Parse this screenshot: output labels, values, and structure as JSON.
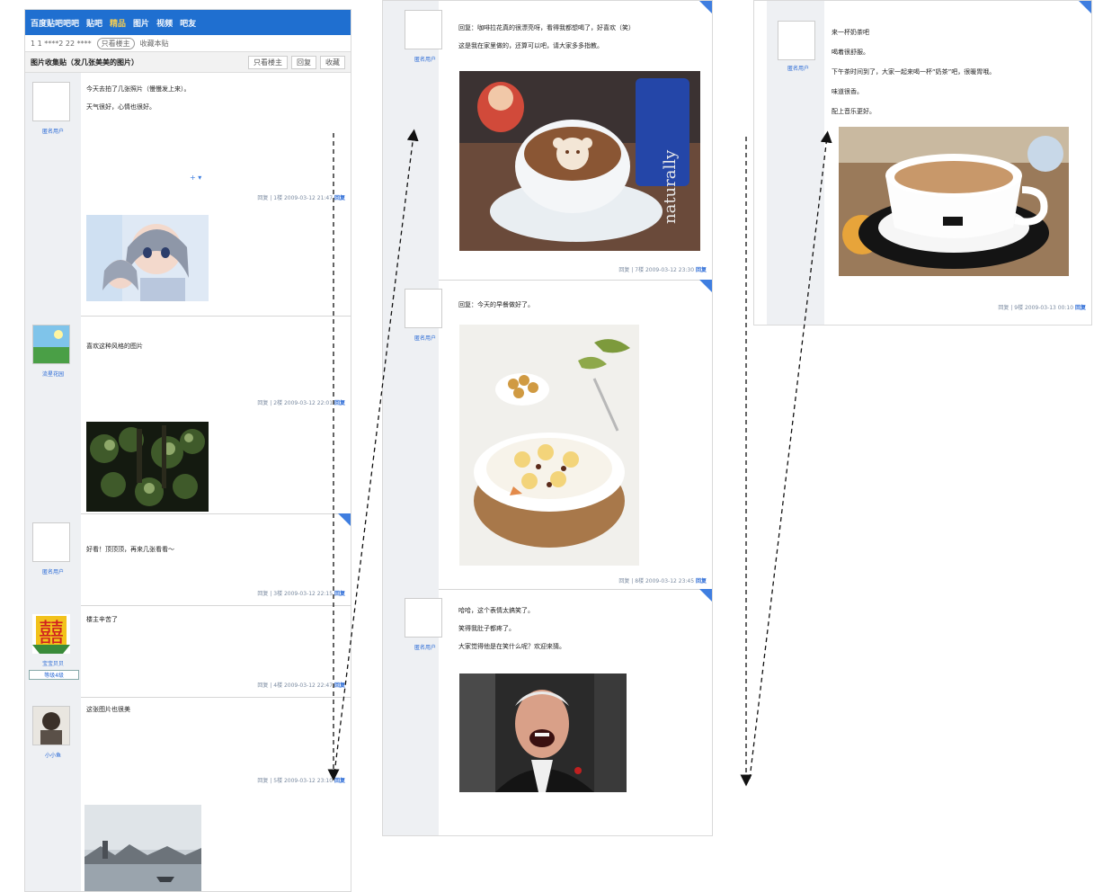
{
  "column1": {
    "topbar": {
      "title": "百度贴吧吧吧",
      "items": [
        "贴吧",
        "精品",
        "图片",
        "视频",
        "吧友"
      ]
    },
    "subbar": {
      "text": "1 1 ****2 22 ****",
      "pill": "只看楼主",
      "extra": "收藏本贴"
    },
    "thread": {
      "title": "图片收集贴（发几张美美的图片）",
      "tools": [
        "只看楼主",
        "回复",
        "收藏"
      ]
    },
    "posts": [
      {
        "user": "匿名用户",
        "lines": [
          "今天去拍了几张照片（慢慢发上来）。",
          "天气很好，心情也很好。"
        ],
        "plus": "+ ▾",
        "meta": "回复 | 1楼 2009-03-12 21:47",
        "reply": "回复"
      },
      {
        "user": "流星花园",
        "lines": [
          "喜欢这种风格的图片"
        ],
        "meta": "回复 | 2楼 2009-03-12 22:01",
        "reply": "回复"
      },
      {
        "user": "匿名用户",
        "lines": [
          "好看！顶顶顶，再来几张看看～"
        ],
        "meta": "回复 | 3楼 2009-03-12 22:15",
        "reply": "回复"
      },
      {
        "user": "宝宝贝贝",
        "badge": "等级4级",
        "lines": [
          "楼主辛苦了"
        ],
        "meta": "回复 | 4楼 2009-03-12 22:47",
        "reply": "回复"
      },
      {
        "user": "小小鱼",
        "lines": [
          "这张图片也很美"
        ],
        "meta": "回复 | 5楼 2009-03-12 23:10",
        "reply": "回复"
      }
    ]
  },
  "column2": {
    "posts": [
      {
        "user": "匿名用户",
        "lines": [
          "回复：咖啡拉花真的很漂亮呀，看得我都想喝了，好喜欢（笑）",
          "这是我在家里做的，还算可以吧，请大家多多指教。"
        ],
        "meta": "回复 | 7楼 2009-03-12 23:30",
        "reply": "回复"
      },
      {
        "user": "匿名用户",
        "lines": [
          "回复：今天的早餐做好了。"
        ],
        "meta": "回复 | 8楼 2009-03-12 23:45",
        "reply": "回复"
      },
      {
        "user": "匿名用户",
        "lines": [
          "哈哈，这个表情太搞笑了。",
          "笑得我肚子都疼了。",
          "大家觉得他是在笑什么呢？欢迎来猜。"
        ],
        "meta": "",
        "reply": ""
      }
    ]
  },
  "column3": {
    "posts": [
      {
        "user": "匿名用户",
        "lines": [
          "来一杯奶茶吧",
          "喝着很舒服。",
          "下午茶时间到了，大家一起来喝一杯“奶茶”吧，很暖胃哦。",
          "味道很香。",
          "配上音乐更好。"
        ],
        "meta": "回复 | 9楼 2009-03-13 00:10",
        "reply": "回复"
      }
    ]
  },
  "images": {
    "anime": "anime-girls-illustration",
    "forest": "dark-forest-photo",
    "village": "water-village-ink-photo",
    "latte": "bear-latte-art-photo",
    "breakfast": "banana-yogurt-bowl-photo",
    "laughing": "laughing-man-photo",
    "milktea": "milk-tea-cup-photo"
  },
  "colors": {
    "accent": "#1f6fd0",
    "link": "#2a6ad6",
    "corner": "#3f7ee0"
  }
}
